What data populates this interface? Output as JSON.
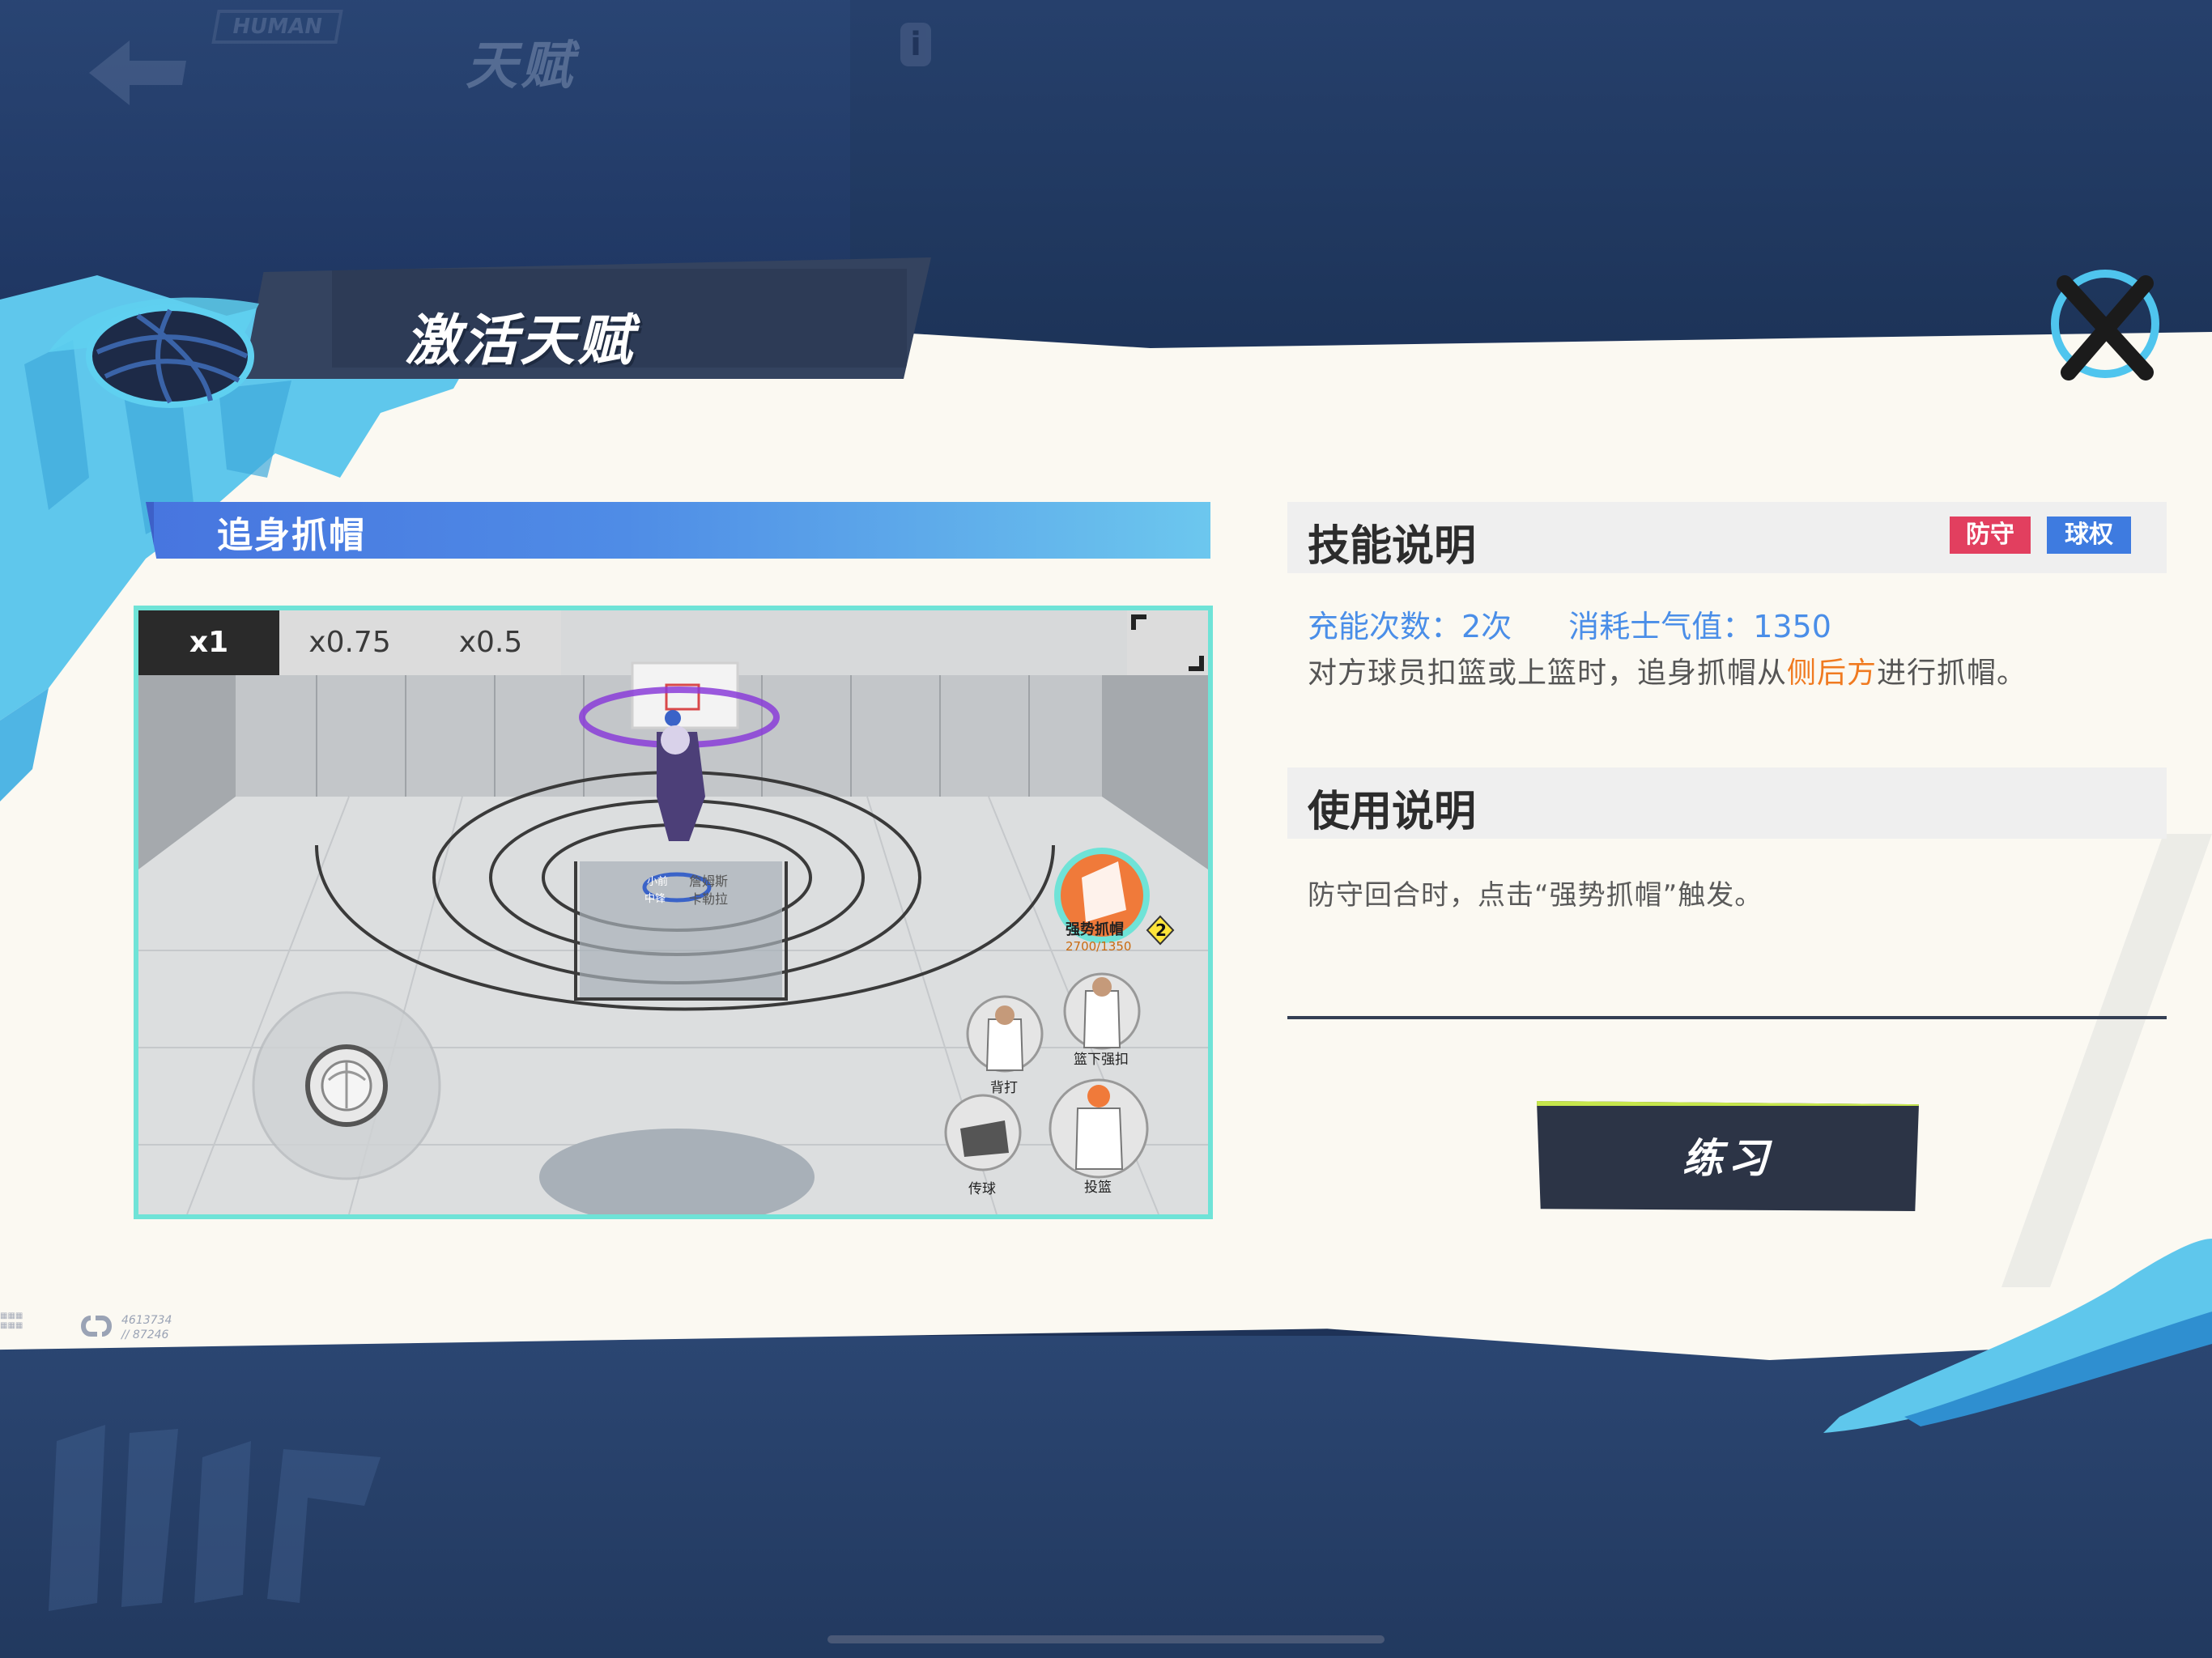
{
  "background": {
    "page_title": "天赋",
    "brand_tag": "HUMAN"
  },
  "dialog": {
    "title": "激活天赋",
    "skill_name": "追身抓帽",
    "video": {
      "speed_options": [
        "x1",
        "x0.75",
        "x0.5"
      ],
      "selected_speed": "x1",
      "scene": {
        "player_labels": [
          "小前",
          "詹姆斯",
          "中锋",
          "卡勒拉"
        ],
        "skill_button": {
          "label": "强势抓帽",
          "value": "2700/1350",
          "charges": "2"
        },
        "action_buttons": [
          "篮下强扣",
          "背打",
          "传球",
          "投篮"
        ]
      }
    },
    "skill_section": {
      "title": "技能说明",
      "tags": [
        "防守",
        "球权"
      ],
      "charges_text": "充能次数：2次",
      "cost_text": "消耗士气值：1350",
      "description_before": "对方球员扣篮或上篮时，追身抓帽从",
      "description_highlight": "侧后方",
      "description_after": "进行抓帽。"
    },
    "usage_section": {
      "title": "使用说明",
      "text": "防守回合时，点击“强势抓帽”触发。"
    },
    "practice_button": "练习",
    "footer_id_1": "4613734",
    "footer_id_2": "// 87246"
  },
  "colors": {
    "accent_cyan": "#6fe3d7",
    "tag_defense": "#e23f5f",
    "tag_ball": "#3e7be0",
    "stat_blue": "#4a8ee8",
    "highlight_orange": "#f07a20",
    "button_dark": "#2c3446"
  }
}
